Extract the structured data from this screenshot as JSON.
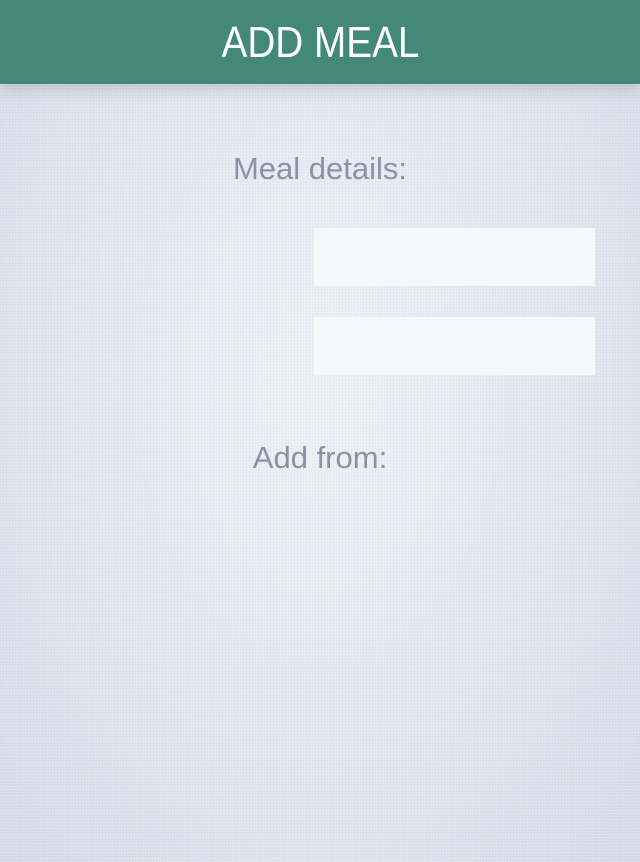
{
  "header": {
    "title": "ADD MEAL",
    "background_color": "#438878"
  },
  "meal_details": {
    "label": "Meal details:",
    "fields": [
      {
        "value": "",
        "placeholder": ""
      },
      {
        "value": "",
        "placeholder": ""
      }
    ]
  },
  "add_from": {
    "label": "Add from:"
  },
  "colors": {
    "label_text": "#8a92a4",
    "background": "#e3e6ef",
    "field_background": "#f7f8fb"
  }
}
